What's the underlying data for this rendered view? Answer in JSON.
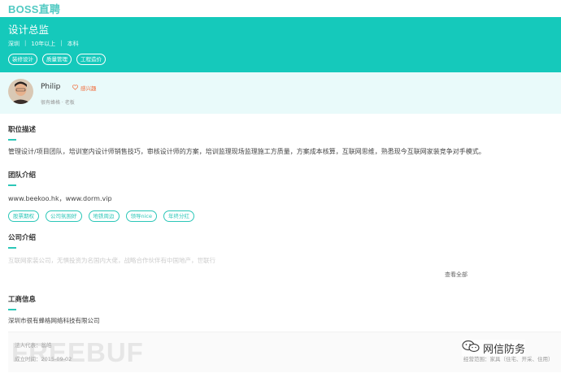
{
  "brand": {
    "logo_text": "BOSS直聘"
  },
  "job": {
    "title": "设计总监",
    "meta": [
      "深圳",
      "10年以上",
      "本科"
    ],
    "meta_sep": "|",
    "tags": [
      "装修设计",
      "质量管理",
      "工程造价"
    ]
  },
  "boss": {
    "name": "Philip",
    "interest_label": "感兴趣",
    "subtitle": "很有蜂格 · 老板"
  },
  "job_desc": {
    "title": "职位描述",
    "text": "管理设计/项目团队，培训室内设计师销售技巧，审核设计师的方案，培训监理现场监理施工方质量，方案成本核算，互联网思维，熟悉现今互联网家装竞争对手模式。"
  },
  "team": {
    "title": "团队介绍",
    "text": "www.beekoo.hk，www.dorm.vip",
    "tags": [
      "股票期权",
      "公司氛围好",
      "地铁周边",
      "领导nice",
      "年终分红"
    ]
  },
  "company": {
    "title": "公司介绍",
    "text_faded": "互联网家装公司，无惧投资为名国内大佬，战略合作伙伴有中国地产，世联行",
    "view_all": "查看全部"
  },
  "business": {
    "title": "工商信息",
    "company_name": "深圳市很有蜂格网络科技有限公司",
    "legal_rep": "法人代表：翁皓",
    "founded": "成立时间：2015-09-02",
    "scope_right": "经营范围：家具（住宅、开采、住用）"
  },
  "overlay": {
    "watermark": "FREEBUF",
    "wx_label": "网信防务"
  },
  "colors": {
    "teal": "#15c9bb",
    "accent": "#2cc7b8",
    "orange": "#f26d3d"
  }
}
